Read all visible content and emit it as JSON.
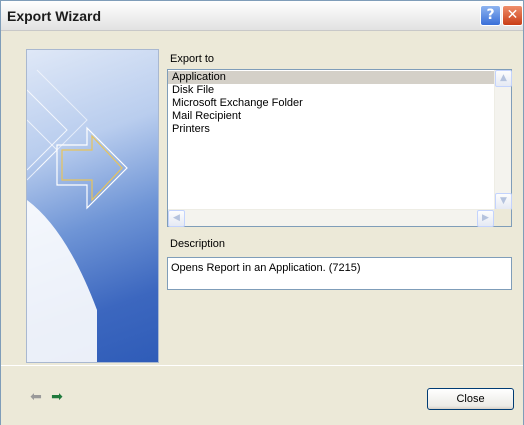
{
  "window": {
    "title": "Export Wizard",
    "help_icon": "question-icon",
    "close_icon": "close-icon"
  },
  "export": {
    "label": "Export to",
    "items": [
      {
        "label": "Application",
        "selected": true
      },
      {
        "label": "Disk File",
        "selected": false
      },
      {
        "label": "Microsoft Exchange Folder",
        "selected": false
      },
      {
        "label": "Mail Recipient",
        "selected": false
      },
      {
        "label": "Printers",
        "selected": false
      }
    ]
  },
  "description": {
    "label": "Description",
    "text": "Opens Report in an Application. (7215)"
  },
  "footer": {
    "back_icon": "arrow-left-icon",
    "forward_icon": "arrow-right-icon",
    "close_label": "Close"
  },
  "colors": {
    "accent_forward": "#1f7a3c",
    "selection": "#d4d0c8",
    "border": "#7f9db9"
  }
}
